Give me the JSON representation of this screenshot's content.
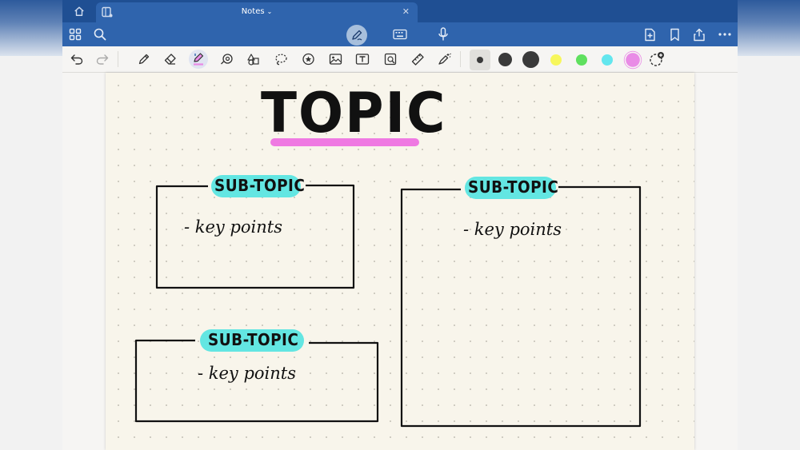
{
  "window": {
    "tab_title": "Notes",
    "tab_chevron": "⌄",
    "tab_close": "✕"
  },
  "icons": {
    "home": "home-icon",
    "tab_doc": "tab-document-icon",
    "grid": "grid-icon",
    "search": "search-icon",
    "pen_mode": "pen-mode-icon",
    "keyboard": "keyboard-icon",
    "mic": "microphone-icon",
    "add_page": "add-page-icon",
    "bookmark": "bookmark-icon",
    "share": "share-icon",
    "more": "more-icon"
  },
  "toolbar": {
    "tools": [
      "undo-icon",
      "redo-icon",
      "pen-icon",
      "eraser-icon",
      "highlighter-icon",
      "shape-icon",
      "elements-icon",
      "lasso-icon",
      "sticker-icon",
      "image-icon",
      "text-icon",
      "scan-icon",
      "ruler-icon",
      "laser-icon"
    ],
    "colors": [
      "#f7f75c",
      "#5fe05f",
      "#63e6ee",
      "#e98be6"
    ],
    "stroke_dark": "#3a3a3a"
  },
  "note": {
    "title": "TOPIC",
    "title_highlight": "#ef79e2",
    "sub_highlight": "#63e6e2",
    "sections": [
      {
        "heading": "SUB-TOPIC",
        "points": "- key points"
      },
      {
        "heading": "SUB-TOPIC",
        "points": "- key points"
      },
      {
        "heading": "SUB-TOPIC",
        "points": "- key points"
      }
    ]
  }
}
